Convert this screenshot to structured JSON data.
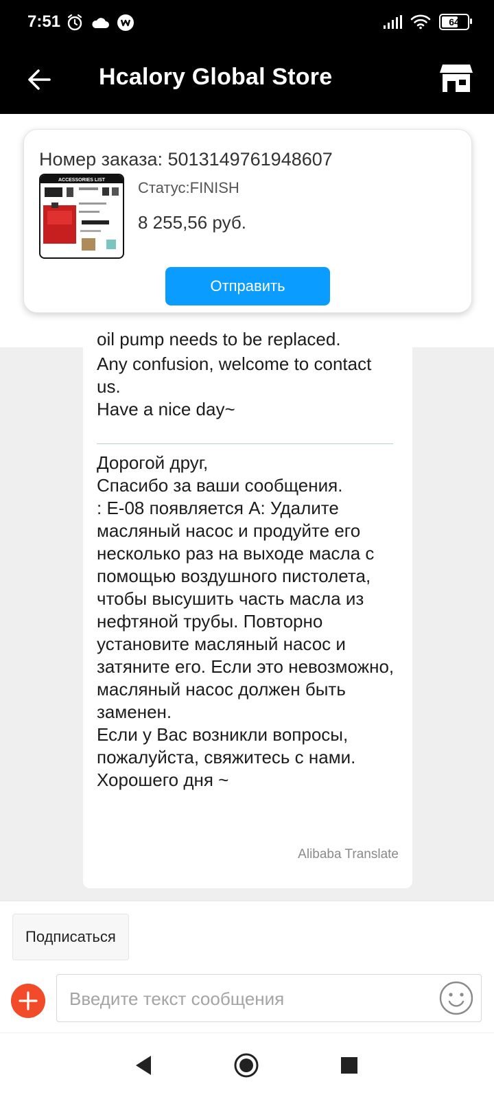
{
  "status_bar": {
    "time": "7:51",
    "battery": "64",
    "battery_level": 0.64,
    "icons": [
      "alarm-icon",
      "cloud-icon",
      "w-app-icon",
      "signal-icon",
      "wifi-icon",
      "battery-icon"
    ]
  },
  "header": {
    "title": "Hcalory Global Store",
    "icons": [
      "back-arrow-icon",
      "store-icon"
    ]
  },
  "order": {
    "number_label": "Номер заказа: 5013149761948607",
    "status": "Статус:FINISH",
    "price": "8 255,56 руб.",
    "send_button": "Отправить",
    "thumb_title": "ACCESSORIES LIST"
  },
  "message": {
    "partial_top": "oil pump needs to be replaced.",
    "english": "Any confusion, welcome to contact us.\nHave a nice day~",
    "russian": "Дорогой друг,\nСпасибо за ваши сообщения.\n: E-08 появляется A: Удалите масляный насос и продуйте его несколько раз на выходе масла с помощью воздушного пистолета, чтобы высушить часть масла из нефтяной трубы. Повторно установите масляный насос и затяните его. Если это невозможно, масляный насос должен быть заменен.\nЕсли у Вас возникли вопросы, пожалуйста, свяжитесь с нами.\nХорошего дня ~",
    "translate_note": "Alibaba Translate"
  },
  "bottom": {
    "subscribe_button": "Подписаться",
    "input_placeholder": "Введите текст сообщения",
    "input_value": ""
  },
  "colors": {
    "accent_blue": "#0b9cff",
    "plus_red": "#f24b2a",
    "header_bg": "#000000",
    "chat_bg": "#efefef"
  }
}
